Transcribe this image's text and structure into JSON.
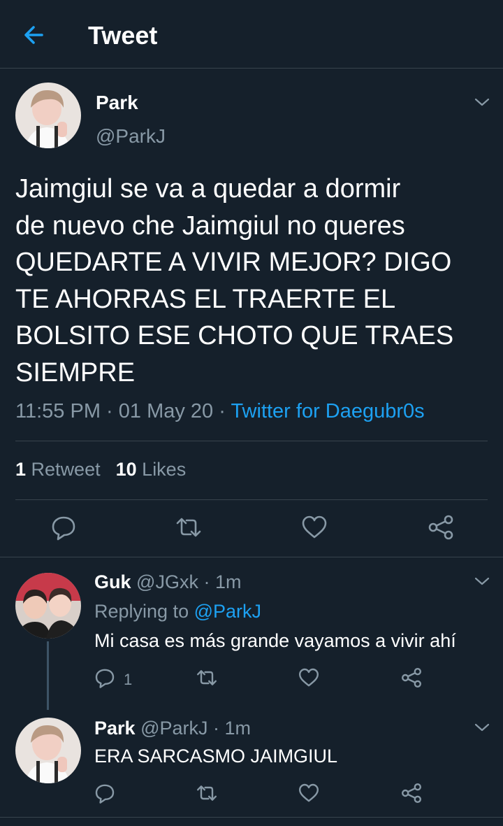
{
  "header": {
    "title": "Tweet"
  },
  "main_tweet": {
    "name": "Park",
    "handle": "@ParkJ",
    "lines": [
      "Jaimgiul se va a quedar a dormir",
      "de nuevo che Jaimgiul no queres",
      "QUEDARTE A VIVIR MEJOR? DIGO",
      "TE AHORRAS EL TRAERTE EL",
      "BOLSITO ESE CHOTO QUE TRAES",
      "SIEMPRE"
    ],
    "time": "11:55 PM",
    "dot": " · ",
    "date": "01 May 20",
    "source": "Twitter for Daegubr0s",
    "retweet_count": "1",
    "retweet_label": "Retweet",
    "like_count": "10",
    "like_label": "Likes"
  },
  "replies": [
    {
      "name": "Guk",
      "handle": "@JGxk",
      "sep": " · ",
      "time": "1m",
      "replying_label": "Replying to ",
      "replying_to": "@ParkJ",
      "text": "Mi casa es más grande vayamos a vivir ahí",
      "reply_count": "1"
    },
    {
      "name": "Park",
      "handle": "@ParkJ",
      "sep": " · ",
      "time": "1m",
      "text": "ERA SARCASMO JAIMGIUL"
    }
  ],
  "icons": {
    "back": "back-arrow-icon",
    "caret": "chevron-down-icon",
    "reply": "reply-icon",
    "retweet": "retweet-icon",
    "like": "heart-icon",
    "share": "share-icon"
  },
  "colors": {
    "background": "#15202b",
    "accent": "#1da1f2",
    "muted": "#8899a6",
    "divider": "#38444d"
  }
}
